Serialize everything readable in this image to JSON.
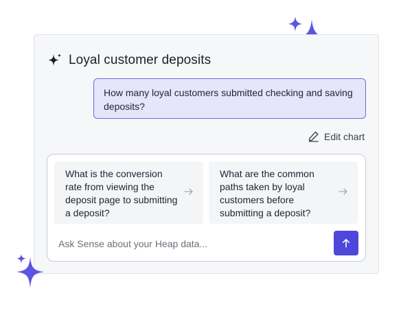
{
  "panel": {
    "title": "Loyal customer deposits",
    "title_icon": "sparkle-icon"
  },
  "message": {
    "text": "How many loyal customers submitted checking and saving deposits?"
  },
  "actions": {
    "edit_chart_label": "Edit chart",
    "edit_icon": "pencil-icon"
  },
  "suggestions": [
    {
      "text": "What is the conversion rate from viewing the deposit page to submitting a deposit?"
    },
    {
      "text": "What are the common paths taken by loyal customers before submitting a deposit?"
    }
  ],
  "composer": {
    "placeholder": "Ask Sense about your Heap data...",
    "value": "",
    "send_icon": "arrow-up-icon"
  },
  "colors": {
    "accent": "#4d48d9",
    "bubble_bg": "#e5e5fb",
    "bubble_border": "#6c6ad8",
    "sparkle": "#5b55e0"
  }
}
